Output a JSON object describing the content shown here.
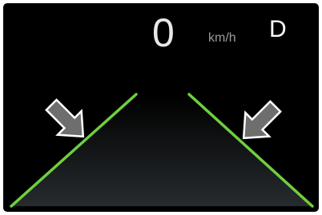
{
  "speedometer": {
    "speed_value": "0",
    "speed_unit": "km/h"
  },
  "transmission": {
    "gear": "D"
  },
  "lane_guide": {
    "line_color": "#6fcf3f",
    "road_color": "#1f2326",
    "arrow_fill": "#6e6e6e",
    "arrow_outline": "#ffffff",
    "left_arrow_icon": "arrow-down-right-icon",
    "right_arrow_icon": "arrow-down-left-icon"
  }
}
